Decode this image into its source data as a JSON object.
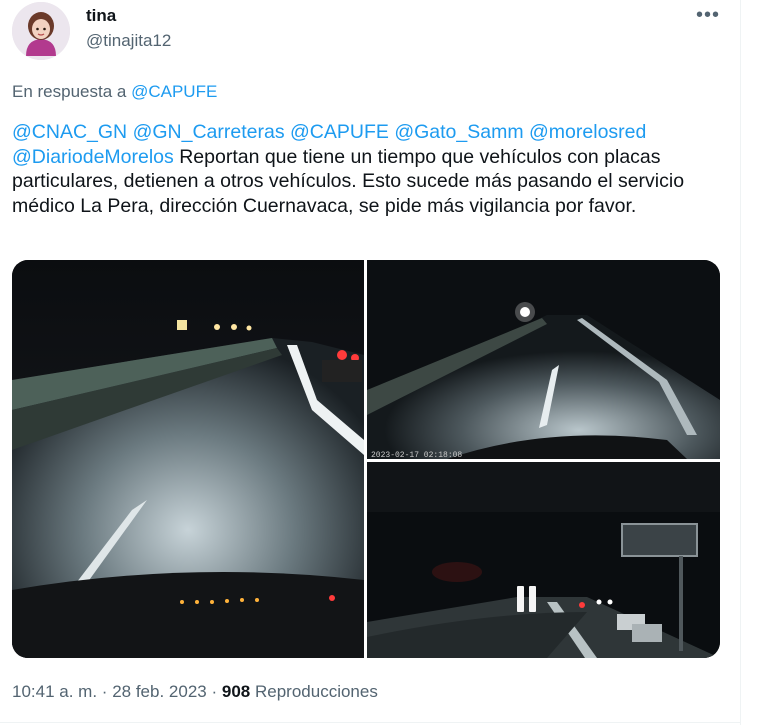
{
  "author": {
    "name": "tina",
    "handle": "@tinajita12"
  },
  "more_icon": "more-horizontal-icon",
  "reply": {
    "prefix": "En respuesta a",
    "to": "@CAPUFE"
  },
  "tweet": {
    "mentions": [
      "@CNAC_GN",
      "@GN_Carreteras",
      "@CAPUFE",
      "@Gato_Samm",
      "@morelosred",
      "@DiariodeMorelos"
    ],
    "body": "Reportan que tiene un tiempo que vehículos con placas particulares, detienen a otros vehículos. Esto sucede más pasando el servicio médico La Pera, dirección Cuernavaca, se pide más vigilancia por favor."
  },
  "media": {
    "timestamp_overlay": "2023-02-17 02:18:08",
    "icon": "pause-icon"
  },
  "meta": {
    "time": "10:41 a. m.",
    "separator": "·",
    "date": "28 feb. 2023",
    "views_count": "908",
    "views_label": "Reproducciones"
  },
  "colors": {
    "link": "#1d9bf0",
    "muted": "#536471",
    "text": "#0f1419"
  }
}
